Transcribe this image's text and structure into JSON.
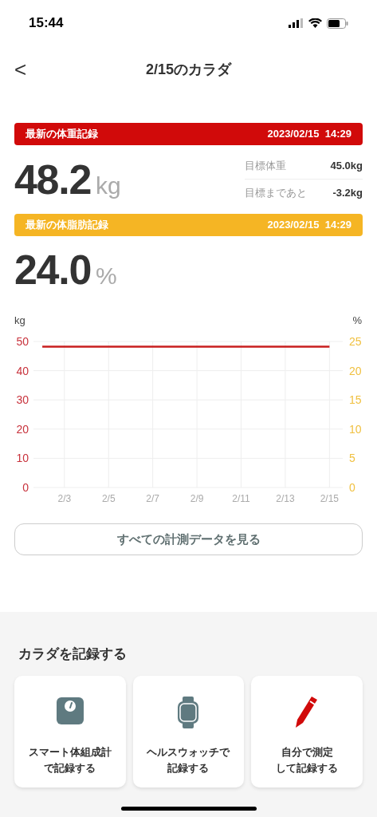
{
  "status_bar": {
    "time": "15:44"
  },
  "header": {
    "back": "<",
    "title": "2/15のカラダ"
  },
  "weight": {
    "label": "最新の体重記録",
    "datetime": "2023/02/15  14:29",
    "value": "48.2",
    "unit": "kg",
    "color": "#d10a0a",
    "goals": [
      {
        "label": "目標体重",
        "value": "45.0kg"
      },
      {
        "label": "目標まであと",
        "value": "-3.2kg"
      }
    ]
  },
  "body_fat": {
    "label": "最新の体脂肪記録",
    "datetime": "2023/02/15  14:29",
    "value": "24.0",
    "unit": "%",
    "color": "#f5b524"
  },
  "chart": {
    "right_unit": "%",
    "right_ticks": [
      "25",
      "20",
      "15",
      "10",
      "5",
      "0"
    ],
    "chart_data": {
      "type": "line",
      "ylabel": "kg",
      "grid": true,
      "categories": [
        null,
        "2/3",
        null,
        "2/5",
        null,
        "2/7",
        null,
        "2/9",
        null,
        "2/11",
        null,
        "2/13",
        null,
        "2/15"
      ],
      "ylim": [
        0,
        50
      ],
      "yticks": [
        0,
        10,
        20,
        30,
        40,
        50
      ],
      "series": [
        {
          "color": "#c81e1e",
          "values": [
            48.2,
            48.2,
            48.2,
            48.2,
            48.2,
            48.2,
            48.2,
            48.2,
            48.2,
            48.2,
            48.2,
            48.2,
            48.2,
            48.2
          ]
        }
      ]
    }
  },
  "all_data_button": "すべての計測データを見る",
  "record": {
    "title": "カラダを記録する",
    "options": [
      {
        "kind": "scale",
        "lines": [
          "スマート体組成計",
          "で記録する"
        ]
      },
      {
        "kind": "watch",
        "lines": [
          "ヘルスウォッチで",
          "記録する"
        ]
      },
      {
        "kind": "pencil",
        "lines": [
          "自分で測定",
          "して記録する"
        ]
      }
    ]
  }
}
